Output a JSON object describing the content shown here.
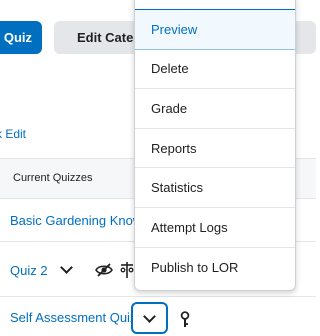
{
  "toolbar": {
    "new_label": "Quiz",
    "edit_categories_label": "Edit Catego"
  },
  "bulk_edit_label": "k Edit",
  "table": {
    "header": "Current Quizzes",
    "rows": [
      {
        "title": "Basic Gardening Know"
      },
      {
        "title": "Quiz 2"
      },
      {
        "title": "Self Assessment Quiz"
      }
    ]
  },
  "context_menu": {
    "items": [
      "Preview",
      "Delete",
      "Grade",
      "Reports",
      "Statistics",
      "Attempt Logs",
      "Publish to LOR"
    ]
  },
  "icons": {
    "chevron": "chevron-down-icon",
    "hidden": "eye-slash-icon",
    "restrictions": "restrictions-icon",
    "key": "key-icon"
  },
  "colors": {
    "accent": "#006fbf",
    "menu_active_bg": "#f1f9ff"
  }
}
